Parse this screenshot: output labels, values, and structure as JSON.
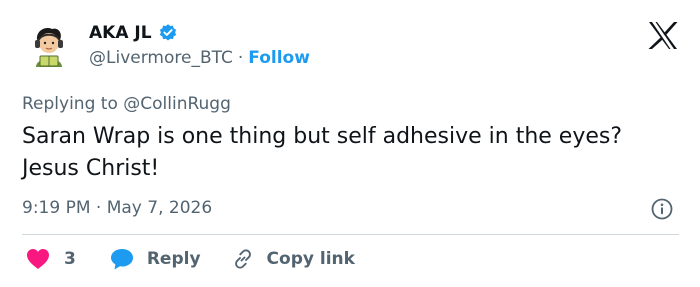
{
  "author": {
    "name": "AKA JL",
    "handle": "@Livermore_BTC",
    "separator": "·",
    "follow_label": "Follow"
  },
  "reply_context": {
    "prefix": "Replying to",
    "mention": "@CollinRugg"
  },
  "tweet": {
    "text": "Saran Wrap is one thing but self adhesive in the eyes? Jesus Christ!",
    "time": "9:19 PM",
    "separator": "·",
    "date": "May 7, 2026"
  },
  "actions": {
    "likes_count": "3",
    "reply_label": "Reply",
    "copy_link_label": "Copy link"
  },
  "icons": {
    "verified": "verified-badge-icon",
    "brand": "x-logo-icon",
    "info": "info-icon",
    "like": "heart-icon",
    "reply": "speech-bubble-icon",
    "copy": "link-icon"
  },
  "colors": {
    "accent": "#1d9bf0",
    "like": "#f91880",
    "text": "#0f1419",
    "secondary_text": "#536471",
    "divider": "#cfd9de"
  }
}
